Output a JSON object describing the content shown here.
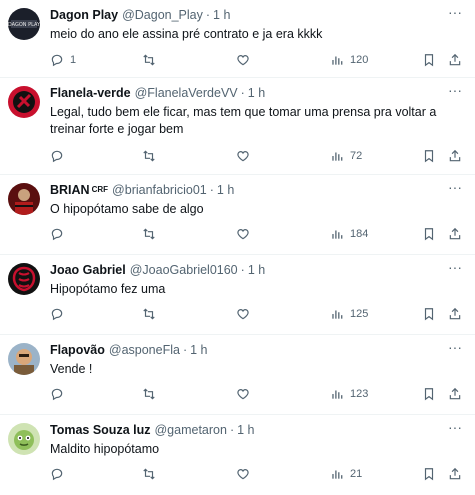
{
  "tweets": [
    {
      "name": "Dagon Play",
      "badge": "",
      "handle": "@Dagon_Play",
      "sep": "·",
      "time": "1 h",
      "text": "meio do ano ele assina pré contrato e ja era kkkk",
      "replies": "1",
      "retweets": "",
      "likes": "",
      "views": "120",
      "avatar_color": "#1b1f2a"
    },
    {
      "name": "Flanela-verde",
      "badge": "",
      "handle": "@FlanelaVerdeVV",
      "sep": "·",
      "time": "1 h",
      "text": "Legal, tudo bem ele ficar, mas tem que tomar uma prensa pra voltar a treinar forte e jogar bem",
      "replies": "",
      "retweets": "",
      "likes": "",
      "views": "72",
      "avatar_color": "#c8102e"
    },
    {
      "name": "BRIAN",
      "badge": "CRF",
      "handle": "@brianfabricio01",
      "sep": "·",
      "time": "1 h",
      "text": "O hipopótamo sabe de algo",
      "replies": "",
      "retweets": "",
      "likes": "",
      "views": "184",
      "avatar_color": "#8b1a1a"
    },
    {
      "name": "Joao Gabriel",
      "badge": "",
      "handle": "@JoaoGabriel0160",
      "sep": "·",
      "time": "1 h",
      "text": "Hipopótamo fez uma",
      "replies": "",
      "retweets": "",
      "likes": "",
      "views": "125",
      "avatar_color": "#111111"
    },
    {
      "name": "Flapovão",
      "badge": "",
      "handle": "@asponeFla",
      "sep": "·",
      "time": "1 h",
      "text": "Vende !",
      "replies": "",
      "retweets": "",
      "likes": "",
      "views": "123",
      "avatar_color": "#7a5c3a"
    },
    {
      "name": "Tomas Souza luz",
      "badge": "",
      "handle": "@gametaron",
      "sep": "·",
      "time": "1 h",
      "text": "Maldito hipopótamo",
      "replies": "",
      "retweets": "",
      "likes": "",
      "views": "21",
      "avatar_color": "#8fbf5a"
    }
  ]
}
